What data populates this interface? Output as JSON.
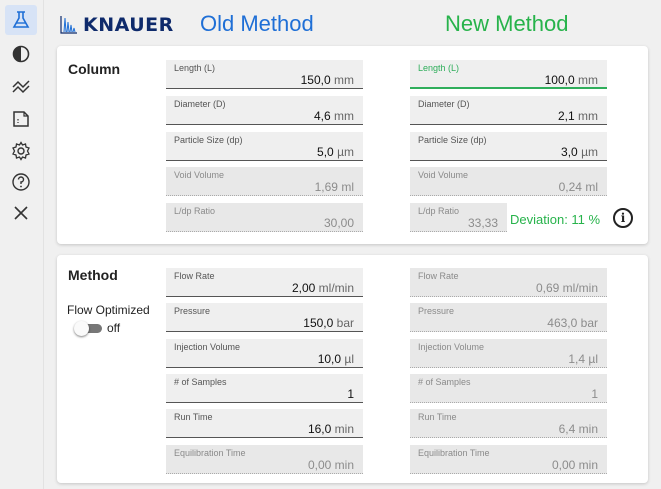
{
  "header": {
    "logo_text": "KNAUER",
    "old_title": "Old Method",
    "new_title": "New Method"
  },
  "sidebar": {
    "items": [
      {
        "icon": "flask-icon",
        "active": true
      },
      {
        "icon": "contrast-icon"
      },
      {
        "icon": "double-chevron-up-icon"
      },
      {
        "icon": "document-icon"
      },
      {
        "icon": "gear-icon"
      },
      {
        "icon": "help-icon"
      },
      {
        "icon": "close-icon"
      }
    ]
  },
  "column": {
    "title": "Column",
    "old": {
      "length": {
        "label": "Length (L)",
        "value": "150,0",
        "unit": "mm"
      },
      "diameter": {
        "label": "Diameter (D)",
        "value": "4,6",
        "unit": "mm"
      },
      "particle": {
        "label": "Particle Size (dp)",
        "value": "5,0",
        "unit": "µm"
      },
      "void": {
        "label": "Void Volume",
        "value": "1,69",
        "unit": "ml"
      },
      "ratio": {
        "label": "L/dp Ratio",
        "value": "30,00",
        "unit": ""
      }
    },
    "new": {
      "length": {
        "label": "Length (L)",
        "value": "100,0",
        "unit": "mm"
      },
      "diameter": {
        "label": "Diameter (D)",
        "value": "2,1",
        "unit": "mm"
      },
      "particle": {
        "label": "Particle Size (dp)",
        "value": "3,0",
        "unit": "µm"
      },
      "void": {
        "label": "Void Volume",
        "value": "0,24",
        "unit": "ml"
      },
      "ratio": {
        "label": "L/dp Ratio",
        "value": "33,33",
        "unit": ""
      }
    },
    "deviation": "Deviation: 11 %",
    "info_icon": "info-icon"
  },
  "method": {
    "title": "Method",
    "flow_optimized_label": "Flow Optimized",
    "toggle_state": "off",
    "old": {
      "flow": {
        "label": "Flow Rate",
        "value": "2,00",
        "unit": "ml/min"
      },
      "pressure": {
        "label": "Pressure",
        "value": "150,0",
        "unit": "bar"
      },
      "injection": {
        "label": "Injection Volume",
        "value": "10,0",
        "unit": "µl"
      },
      "samples": {
        "label": "# of Samples",
        "value": "1",
        "unit": ""
      },
      "runtime": {
        "label": "Run Time",
        "value": "16,0",
        "unit": "min"
      },
      "equil": {
        "label": "Equilibration Time",
        "value": "0,00",
        "unit": "min"
      }
    },
    "new": {
      "flow": {
        "label": "Flow Rate",
        "value": "0,69",
        "unit": "ml/min"
      },
      "pressure": {
        "label": "Pressure",
        "value": "463,0",
        "unit": "bar"
      },
      "injection": {
        "label": "Injection Volume",
        "value": "1,4",
        "unit": "µl"
      },
      "samples": {
        "label": "# of Samples",
        "value": "1",
        "unit": ""
      },
      "runtime": {
        "label": "Run Time",
        "value": "6,4",
        "unit": "min"
      },
      "equil": {
        "label": "Equilibration Time",
        "value": "0,00",
        "unit": "min"
      }
    }
  },
  "colors": {
    "old_accent": "#1f6fd6",
    "new_accent": "#27b34b",
    "brand": "#0e2a6b"
  }
}
